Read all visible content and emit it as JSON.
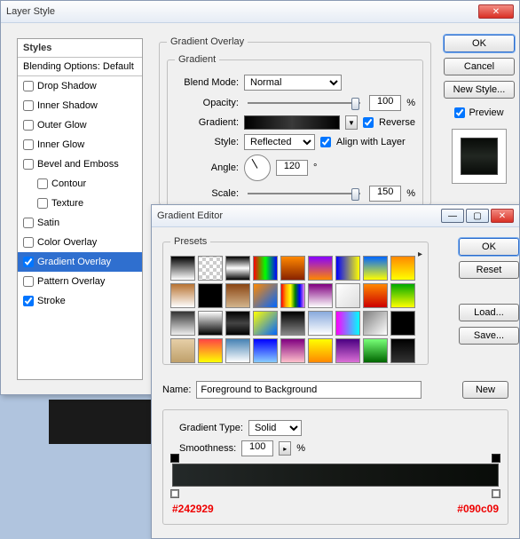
{
  "layerStyle": {
    "title": "Layer Style",
    "stylesHeader": "Styles",
    "blendingDefault": "Blending Options: Default",
    "items": [
      {
        "label": "Drop Shadow",
        "checked": false
      },
      {
        "label": "Inner Shadow",
        "checked": false
      },
      {
        "label": "Outer Glow",
        "checked": false
      },
      {
        "label": "Inner Glow",
        "checked": false
      },
      {
        "label": "Bevel and Emboss",
        "checked": false
      },
      {
        "label": "Contour",
        "checked": false,
        "sub": true
      },
      {
        "label": "Texture",
        "checked": false,
        "sub": true
      },
      {
        "label": "Satin",
        "checked": false
      },
      {
        "label": "Color Overlay",
        "checked": false
      },
      {
        "label": "Gradient Overlay",
        "checked": true,
        "selected": true
      },
      {
        "label": "Pattern Overlay",
        "checked": false
      },
      {
        "label": "Stroke",
        "checked": true
      }
    ],
    "overlay": {
      "legend": "Gradient Overlay",
      "innerLegend": "Gradient",
      "blendModeLabel": "Blend Mode:",
      "blendMode": "Normal",
      "opacityLabel": "Opacity:",
      "opacity": "100",
      "pct": "%",
      "gradientLabel": "Gradient:",
      "reverse": "Reverse",
      "styleLabel": "Style:",
      "style": "Reflected",
      "align": "Align with Layer",
      "angleLabel": "Angle:",
      "angle": "120",
      "deg": "°",
      "scaleLabel": "Scale:",
      "scale": "150"
    },
    "buttons": {
      "ok": "OK",
      "cancel": "Cancel",
      "newStyle": "New Style...",
      "preview": "Preview"
    }
  },
  "gradientEditor": {
    "title": "Gradient Editor",
    "presetsLegend": "Presets",
    "nameLabel": "Name:",
    "name": "Foreground to Background",
    "typeLabel": "Gradient Type:",
    "type": "Solid",
    "smoothLabel": "Smoothness:",
    "smooth": "100",
    "pct": "%",
    "hexLeft": "#242929",
    "hexRight": "#090c09",
    "buttons": {
      "ok": "OK",
      "reset": "Reset",
      "load": "Load...",
      "save": "Save...",
      "new": "New"
    }
  }
}
